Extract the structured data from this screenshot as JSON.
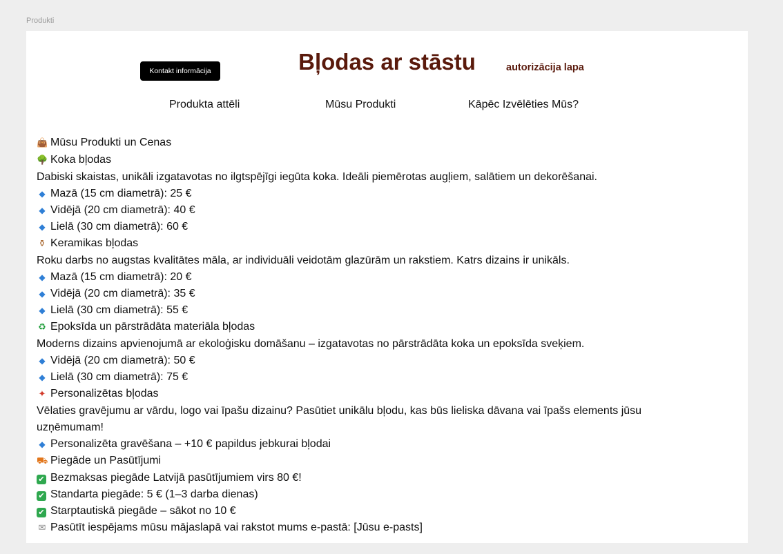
{
  "frame": {
    "label": "Produkti"
  },
  "header": {
    "contact_button": "Kontakt informācija",
    "title": "Bļodas ar stāstu",
    "auth_link": "autorizācija lapa"
  },
  "nav": [
    {
      "label": "Produkta attēli"
    },
    {
      "label": "Mūsu Produkti"
    },
    {
      "label": "Kāpēc Izvēlēties Mūs?"
    }
  ],
  "content": {
    "lines": [
      {
        "icon": "shopping-bags-icon",
        "glyph": "👜",
        "text": "Mūsu Produkti un Cenas"
      },
      {
        "icon": "tree-icon",
        "glyph": "🌳",
        "text": "Koka bļodas"
      },
      {
        "icon": "",
        "glyph": "",
        "text": "Dabiski skaistas, unikāli izgatavotas no ilgtspējīgi iegūta koka. Ideāli piemērotas augļiem, salātiem un dekorēšanai."
      },
      {
        "icon": "blue-diamond-icon",
        "glyph": "◆",
        "text": "Mazā (15 cm diametrā): 25 €"
      },
      {
        "icon": "blue-diamond-icon",
        "glyph": "◆",
        "text": "Vidējā (20 cm diametrā): 40 €"
      },
      {
        "icon": "blue-diamond-icon",
        "glyph": "◆",
        "text": "Lielā (30 cm diametrā): 60 €"
      },
      {
        "icon": "amphora-icon",
        "glyph": "⚱",
        "text": "Keramikas bļodas"
      },
      {
        "icon": "",
        "glyph": "",
        "text": "Roku darbs no augstas kvalitātes māla, ar individuāli veidotām glazūrām un rakstiem. Katrs dizains ir unikāls."
      },
      {
        "icon": "blue-diamond-icon",
        "glyph": "◆",
        "text": "Mazā (15 cm diametrā): 20 €"
      },
      {
        "icon": "blue-diamond-icon",
        "glyph": "◆",
        "text": "Vidējā (20 cm diametrā): 35 €"
      },
      {
        "icon": "blue-diamond-icon",
        "glyph": "◆",
        "text": "Lielā (30 cm diametrā): 55 €"
      },
      {
        "icon": "recycle-icon",
        "glyph": "♻",
        "text": "Epoksīda un pārstrādāta materiāla bļodas"
      },
      {
        "icon": "",
        "glyph": "",
        "text": "Moderns dizains apvienojumā ar ekoloģisku domāšanu – izgatavotas no pārstrādāta koka un epoksīda sveķiem."
      },
      {
        "icon": "blue-diamond-icon",
        "glyph": "◆",
        "text": "Vidējā (20 cm diametrā): 50 €"
      },
      {
        "icon": "blue-diamond-icon",
        "glyph": "◆",
        "text": "Lielā (30 cm diametrā): 75 €"
      },
      {
        "icon": "gift-icon",
        "glyph": "✦",
        "text": "Personalizētas bļodas"
      },
      {
        "icon": "",
        "glyph": "",
        "text": "Vēlaties gravējumu ar vārdu, logo vai īpašu dizainu? Pasūtiet unikālu bļodu, kas būs lieliska dāvana vai īpašs elements jūsu uzņēmumam!"
      },
      {
        "icon": "blue-diamond-icon",
        "glyph": "◆",
        "text": "Personalizēta gravēšana – +10 € papildus jebkurai bļodai"
      },
      {
        "icon": "delivery-truck-icon",
        "glyph": "⛟",
        "text": "Piegāde un Pasūtījumi"
      },
      {
        "icon": "check-mark-icon",
        "glyph": "✔",
        "text": "Bezmaksas piegāde Latvijā pasūtījumiem virs 80 €!"
      },
      {
        "icon": "check-mark-icon",
        "glyph": "✔",
        "text": "Standarta piegāde: 5 € (1–3 darba dienas)"
      },
      {
        "icon": "check-mark-icon",
        "glyph": "✔",
        "text": "Starptautiskā piegāde – sākot no 10 €"
      },
      {
        "icon": "envelope-icon",
        "glyph": "✉",
        "text": "Pasūtīt iespējams mūsu mājaslapā vai rakstot mums e-pastā: [Jūsu e-pasts]"
      }
    ]
  },
  "colors": {
    "title": "#5a1a0c",
    "background": "#eeeeee",
    "card": "#ffffff",
    "button": "#000000"
  }
}
